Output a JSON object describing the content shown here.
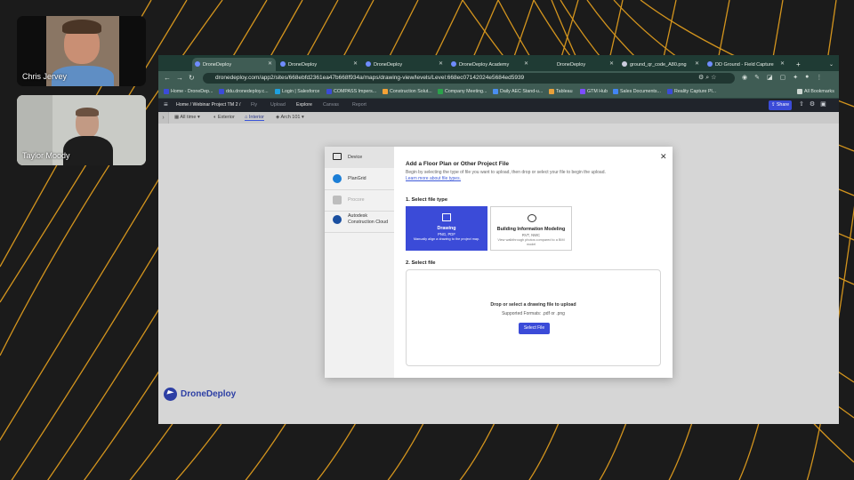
{
  "participants": [
    {
      "name": "Chris Jervey"
    },
    {
      "name": "Taylor Moody"
    }
  ],
  "browser": {
    "tabs": [
      {
        "label": "DroneDeploy",
        "active": true
      },
      {
        "label": "DroneDeploy"
      },
      {
        "label": "DroneDeploy"
      },
      {
        "label": "DroneDeploy Academy"
      },
      {
        "label": "DroneDeploy"
      },
      {
        "label": "ground_qr_code_A80.png"
      },
      {
        "label": "DD Ground - Field Capture"
      }
    ],
    "new_tab": "+",
    "url": "dronedeploy.com/app2/sites/668ebfd2361ea47b668f934a/maps/drawing-view/levels/Level:668ec07142024e5684ed5939",
    "bookmarks": [
      {
        "label": "Home - DroneDep...",
        "color": "#3b4bd8"
      },
      {
        "label": "ddu.dronedeploy.c...",
        "color": "#3b4bd8"
      },
      {
        "label": "Login | Salesforce",
        "color": "#1ea1e0"
      },
      {
        "label": "COMPASS Impers...",
        "color": "#3b4bd8"
      },
      {
        "label": "Construction Solut...",
        "color": "#f4a236"
      },
      {
        "label": "Company Meeting...",
        "color": "#2aa24a"
      },
      {
        "label": "Daily AEC Stand-u...",
        "color": "#4a8ef0"
      },
      {
        "label": "Tableau",
        "color": "#e8a03a"
      },
      {
        "label": "GTM Hub",
        "color": "#7c4dff"
      },
      {
        "label": "Sales Documents...",
        "color": "#4285f4"
      },
      {
        "label": "Reality Capture Pl...",
        "color": "#3b4bd8"
      }
    ],
    "all_bookmarks": "All Bookmarks"
  },
  "app": {
    "breadcrumb": "Home / Webinar Project TM 2 /",
    "nav": [
      "Fly",
      "Upload",
      "Explore",
      "Canvas",
      "Report"
    ],
    "active_nav": "Explore",
    "share": "Share",
    "view_chips": [
      "All time",
      "Exterior",
      "Interior",
      "Arch 101"
    ],
    "brand": "DroneDeploy"
  },
  "modal": {
    "sources": [
      {
        "label": "Device",
        "enabled": true
      },
      {
        "label": "PlanGrid",
        "enabled": true
      },
      {
        "label": "Procore",
        "enabled": false
      },
      {
        "label": "Autodesk Construction Cloud",
        "enabled": true
      }
    ],
    "title": "Add a Floor Plan or Other Project File",
    "description": "Begin by selecting the type of file you want to upload, then drop or select your file to begin the upload.",
    "learn_more": "Learn more about file types.",
    "close": "✕",
    "step1": "1. Select file type",
    "file_types": [
      {
        "title": "Drawing",
        "formats": "PNG, PDF",
        "desc": "Manually align a drawing to the project map."
      },
      {
        "title": "Building Information Modeling",
        "formats": "RVT, NWC",
        "desc": "View walkthrough photos compared to a BIM model"
      }
    ],
    "step2": "2. Select file",
    "drop_title": "Drop or select a drawing file to upload",
    "drop_formats": "Supported Formats: .pdf or .png",
    "select_button": "Select File"
  },
  "colors": {
    "accent": "#3b4bd8",
    "browser_chrome": "#3f5c54",
    "arcs": "#e8a21e",
    "stage_bg": "#1b1b1b"
  }
}
